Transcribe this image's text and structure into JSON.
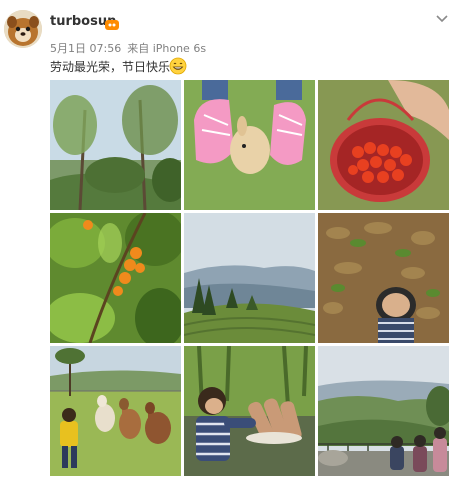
{
  "post": {
    "username": "turbosun",
    "badge_icon": "member-badge-icon",
    "date": "5月1日 07:56",
    "source": "来自 iPhone 6s",
    "text": "劳动最光荣，节日快乐",
    "emoji_icon": "grin-emoji-icon",
    "menu_icon": "chevron-down-icon"
  },
  "photos": [
    {
      "id": 1,
      "subject": "trees-on-hillside"
    },
    {
      "id": 2,
      "subject": "pink-shoes-with-rabbit"
    },
    {
      "id": 3,
      "subject": "basket-of-red-berries"
    },
    {
      "id": 4,
      "subject": "orange-fruits-on-branch"
    },
    {
      "id": 5,
      "subject": "mountain-tea-field-view"
    },
    {
      "id": 6,
      "subject": "child-among-fallen-leaves"
    },
    {
      "id": 7,
      "subject": "child-with-alpacas"
    },
    {
      "id": 8,
      "subject": "child-with-firewood"
    },
    {
      "id": 9,
      "subject": "valley-overlook-with-people"
    }
  ],
  "colors": {
    "username": "#333333",
    "meta": "#808080",
    "badge": "#ff8c00"
  }
}
